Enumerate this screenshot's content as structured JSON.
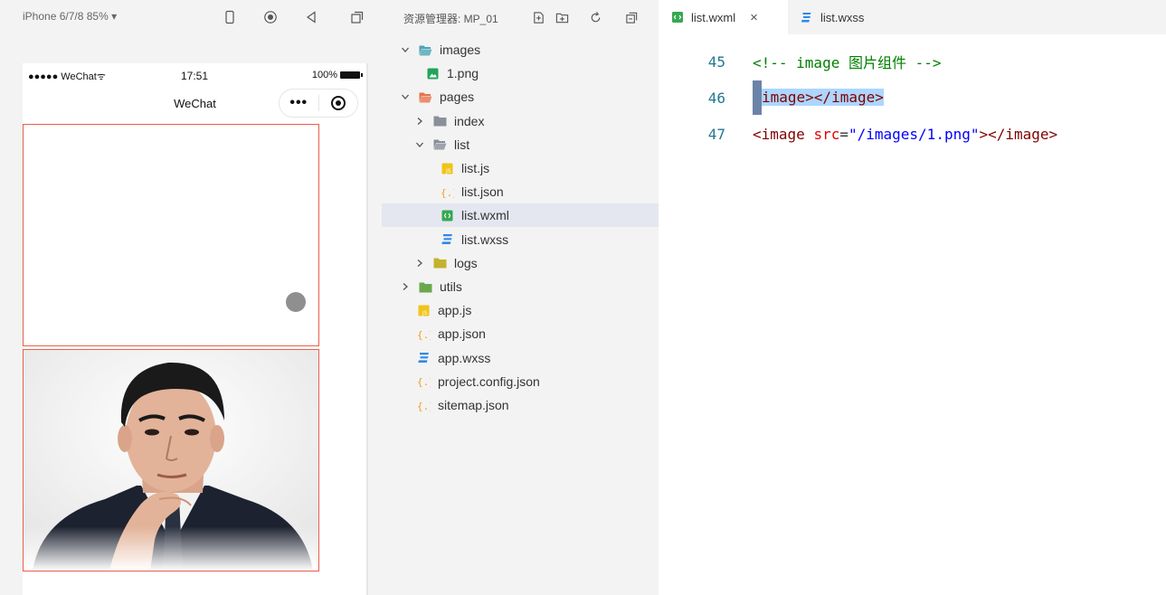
{
  "simulator": {
    "device_select": "iPhone 6/7/8 85% ▾",
    "tools": [
      "phone-icon",
      "record-icon",
      "back-icon",
      "window-icon"
    ],
    "status_bar": {
      "carrier": "●●●●● WeChat",
      "time": "17:51",
      "battery": "100%"
    },
    "nav_title": "WeChat",
    "capsule": {
      "more": "•••"
    }
  },
  "explorer": {
    "title": "资源管理器: MP_01",
    "tools": [
      "new-file-icon",
      "new-folder-icon",
      "refresh-icon",
      "collapse-icon"
    ],
    "tree": [
      {
        "label": "images",
        "type": "folder",
        "expanded": true,
        "depth": 0,
        "icon": "images-folder-icon",
        "color": "#4aa6b8"
      },
      {
        "label": "1.png",
        "type": "file",
        "depth": 1,
        "icon": "image-file-icon",
        "color": "#22a45a"
      },
      {
        "label": "pages",
        "type": "folder",
        "expanded": true,
        "depth": 0,
        "icon": "pages-folder-icon",
        "color": "#e8734c"
      },
      {
        "label": "index",
        "type": "folder",
        "expanded": false,
        "depth": 1,
        "icon": "folder-icon",
        "color": "#8a8f9a"
      },
      {
        "label": "list",
        "type": "folder",
        "expanded": true,
        "depth": 1,
        "icon": "folder-open-icon",
        "color": "#8a8f9a"
      },
      {
        "label": "list.js",
        "type": "file",
        "depth": 2,
        "icon": "js-file-icon",
        "color": "#f0c419"
      },
      {
        "label": "list.json",
        "type": "file",
        "depth": 2,
        "icon": "json-file-icon",
        "color": "#f0a020"
      },
      {
        "label": "list.wxml",
        "type": "file",
        "depth": 2,
        "icon": "wxml-file-icon",
        "color": "#36a852",
        "selected": true
      },
      {
        "label": "list.wxss",
        "type": "file",
        "depth": 2,
        "icon": "css-file-icon",
        "color": "#2e8ae6"
      },
      {
        "label": "logs",
        "type": "folder",
        "expanded": false,
        "depth": 1,
        "icon": "logs-folder-icon",
        "color": "#c3b32d"
      },
      {
        "label": "utils",
        "type": "folder",
        "expanded": false,
        "depth": 0,
        "icon": "utils-folder-icon",
        "color": "#6aa84f"
      },
      {
        "label": "app.js",
        "type": "file",
        "depth": 0,
        "icon": "js-file-icon",
        "color": "#f0c419"
      },
      {
        "label": "app.json",
        "type": "file",
        "depth": 0,
        "icon": "json-file-icon",
        "color": "#f0a020"
      },
      {
        "label": "app.wxss",
        "type": "file",
        "depth": 0,
        "icon": "css-file-icon",
        "color": "#2e8ae6"
      },
      {
        "label": "project.config.json",
        "type": "file",
        "depth": 0,
        "icon": "json-file-icon",
        "color": "#f0a020"
      },
      {
        "label": "sitemap.json",
        "type": "file",
        "depth": 0,
        "icon": "json-file-icon",
        "color": "#f0a020"
      }
    ]
  },
  "editor": {
    "tabs": [
      {
        "label": "list.wxml",
        "icon": "wxml-file-icon",
        "active": true,
        "close": "×"
      },
      {
        "label": "list.wxss",
        "icon": "css-file-icon",
        "active": false
      }
    ],
    "lines": [
      {
        "no": "45",
        "text": "<!-- image 图片组件 -->"
      },
      {
        "no": "46",
        "text": "<image></image>"
      },
      {
        "no": "47",
        "text": "<image src=\"/images/1.png\"></image>"
      }
    ]
  },
  "colors": {
    "selection": "#add6ff",
    "image_border": "#e85f4a",
    "selected_row": "#e4e7f0",
    "line_number": "#237893"
  }
}
